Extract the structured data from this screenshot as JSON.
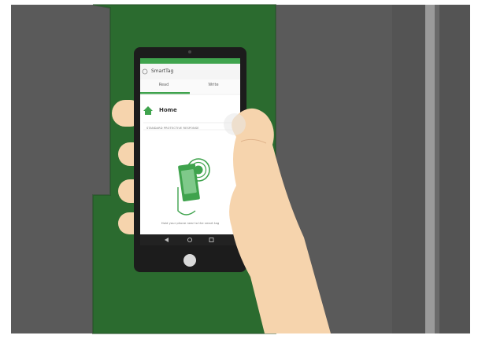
{
  "app": {
    "title": "SmartTag",
    "tabs": [
      {
        "label": "Read"
      },
      {
        "label": "Write"
      }
    ],
    "home_label": "Home",
    "section_label": "STANDARD PROTECTIVE RESPONSE",
    "hint_text": "Hold your phone near to the smart tag"
  },
  "colors": {
    "wall_gray": "#5a5a5a",
    "panel_green": "#2b6b2f",
    "accent_green": "#3fa34d",
    "phone_black": "#1c1c1c",
    "skin": "#f6d4ad"
  },
  "icons": [
    "home-icon",
    "nfc-phone-icon",
    "back-nav-icon",
    "home-nav-icon",
    "recents-nav-icon",
    "menu-icon"
  ]
}
